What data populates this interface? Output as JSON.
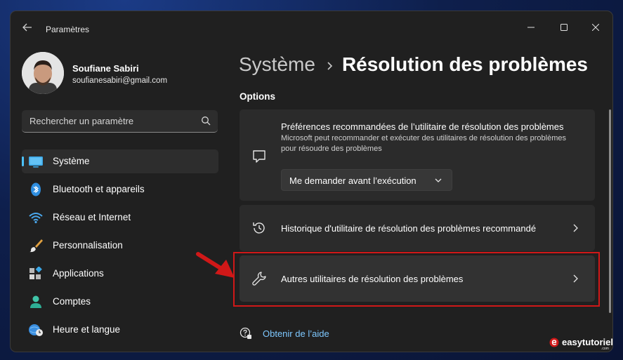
{
  "window": {
    "title": "Paramètres",
    "back_icon": "arrow-left-icon",
    "controls": [
      "minimize-icon",
      "maximize-icon",
      "close-icon"
    ]
  },
  "profile": {
    "name": "Soufiane Sabiri",
    "email": "soufianesabiri@gmail.com"
  },
  "search": {
    "placeholder": "Rechercher un paramètre",
    "icon": "search-icon"
  },
  "sidebar": {
    "items": [
      {
        "label": "Système",
        "icon": "monitor-icon",
        "active": true
      },
      {
        "label": "Bluetooth et appareils",
        "icon": "bluetooth-icon",
        "active": false
      },
      {
        "label": "Réseau et Internet",
        "icon": "wifi-icon",
        "active": false
      },
      {
        "label": "Personnalisation",
        "icon": "paintbrush-icon",
        "active": false
      },
      {
        "label": "Applications",
        "icon": "apps-icon",
        "active": false
      },
      {
        "label": "Comptes",
        "icon": "person-icon",
        "active": false
      },
      {
        "label": "Heure et langue",
        "icon": "globe-clock-icon",
        "active": false
      }
    ]
  },
  "breadcrumb": {
    "parent": "Système",
    "current": "Résolution des problèmes"
  },
  "options": {
    "title": "Options",
    "cards": [
      {
        "title": "Préférences recommandées de l’utilitaire de résolution des problèmes",
        "description": "Microsoft peut recommander et exécuter des utilitaires de résolution des problèmes pour résoudre des problèmes",
        "dropdown_value": "Me demander avant l’exécution",
        "icon": "chat-bubble-icon"
      },
      {
        "title": "Historique d'utilitaire de résolution des problèmes recommandé",
        "icon": "history-icon"
      },
      {
        "title": "Autres utilitaires de résolution des problèmes",
        "icon": "wrench-icon"
      }
    ]
  },
  "help": {
    "label": "Obtenir de l’aide",
    "icon": "help-chat-icon"
  },
  "watermark": {
    "brand": "easytutoriel",
    "sub": ".com"
  },
  "colors": {
    "accent": "#4cc2ff",
    "link": "#7ec8ff",
    "highlight": "#d01818",
    "arrow": "#d01818"
  }
}
